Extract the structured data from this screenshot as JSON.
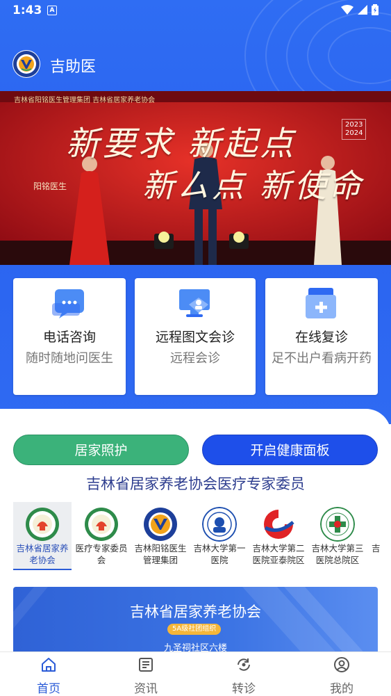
{
  "status_bar": {
    "time": "1:43",
    "notification_icon": "A"
  },
  "app": {
    "title": "吉助医"
  },
  "banner": {
    "caption": "吉林省阳铭医生管理集团  吉林省居家养老协会",
    "headline_1": "新要求 新起点",
    "headline_2": "新ㄙ点 新使命",
    "side_text": "阳铭医生",
    "years": [
      "2023",
      "2024"
    ]
  },
  "services": [
    {
      "title": "电话咨询",
      "subtitle": "随时随地问医生",
      "icon": "chat-bubble-icon"
    },
    {
      "title": "远程图文会诊",
      "subtitle": "远程会诊",
      "icon": "monitor-doctor-icon"
    },
    {
      "title": "在线复诊",
      "subtitle": "足不出户看病开药",
      "icon": "medical-folder-icon"
    }
  ],
  "actions": {
    "home_care": "居家照护",
    "health_panel": "开启健康面板"
  },
  "section": {
    "title": "吉林省居家养老协会医疗专家委员"
  },
  "orgs": [
    {
      "name": "吉林省居家养老协会",
      "icon": "association-logo-icon",
      "active": true
    },
    {
      "name": "医疗专家委员会",
      "icon": "committee-logo-icon",
      "active": false
    },
    {
      "name": "吉林阳铭医生管理集团",
      "icon": "yangming-logo-icon",
      "active": false
    },
    {
      "name": "吉林大学第一医院",
      "icon": "hospital-1-logo-icon",
      "active": false
    },
    {
      "name": "吉林大学第二医院亚泰院区",
      "icon": "hospital-2-logo-icon",
      "active": false
    },
    {
      "name": "吉林大学第三医院总院区",
      "icon": "hospital-3-logo-icon",
      "active": false
    },
    {
      "name": "吉",
      "icon": "",
      "active": false
    }
  ],
  "promo": {
    "title": "吉林省居家养老协会",
    "badge": "5A级社团组织",
    "subtitle": "九圣祠社区六楼"
  },
  "nav": [
    {
      "label": "首页",
      "icon": "home-icon",
      "active": true
    },
    {
      "label": "资讯",
      "icon": "news-icon",
      "active": false
    },
    {
      "label": "转诊",
      "icon": "referral-icon",
      "active": false
    },
    {
      "label": "我的",
      "icon": "profile-icon",
      "active": false
    }
  ],
  "colors": {
    "primary_blue": "#2f6af2",
    "green": "#3bb27a",
    "button_blue": "#1e4fea",
    "banner_red": "#b3121c",
    "title_navy": "#2d3d8f"
  }
}
